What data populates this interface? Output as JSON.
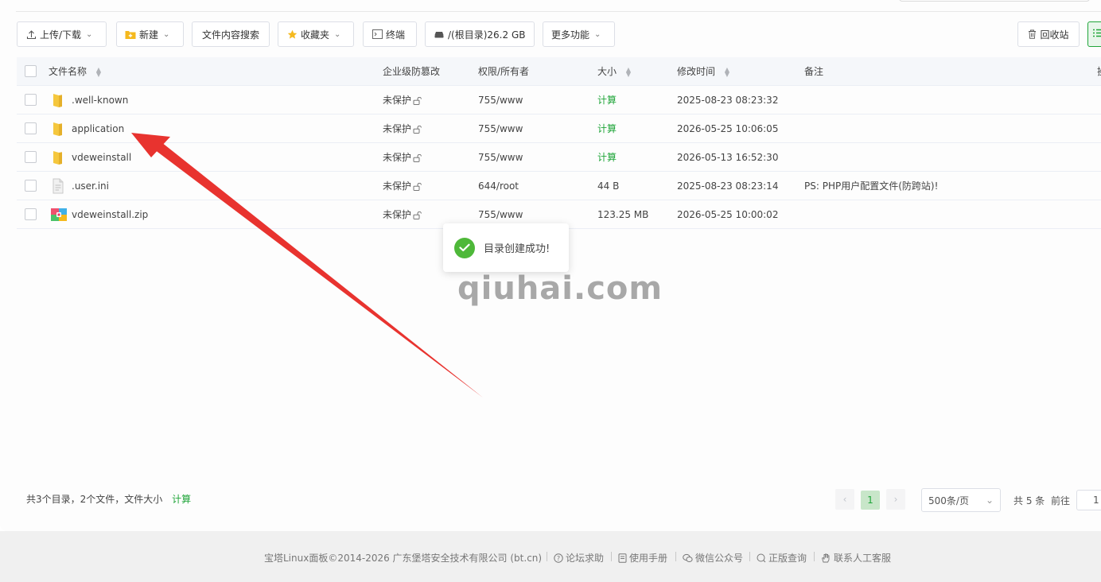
{
  "toolbar": {
    "upload_label": "上传/下载",
    "new_label": "新建",
    "search_content_label": "文件内容搜索",
    "favorites_label": "收藏夹",
    "terminal_label": "终端",
    "disk_label": "/(根目录)26.2 GB",
    "more_label": "更多功能",
    "recycle_label": "回收站"
  },
  "table": {
    "headers": {
      "name": "文件名称",
      "protect": "企业级防篡改",
      "perm": "权限/所有者",
      "size": "大小",
      "mtime": "修改时间",
      "note": "备注",
      "op": "操"
    },
    "rows": [
      {
        "name": ".well-known",
        "type": "folder",
        "protect": "未保护",
        "perm": "755/www",
        "size": "计算",
        "mtime": "2025-08-23 08:23:32",
        "note": ""
      },
      {
        "name": "application",
        "type": "folder",
        "protect": "未保护",
        "perm": "755/www",
        "size": "计算",
        "mtime": "2026-05-25 10:06:05",
        "note": ""
      },
      {
        "name": "vdeweinstall",
        "type": "folder",
        "protect": "未保护",
        "perm": "755/www",
        "size": "计算",
        "mtime": "2026-05-13 16:52:30",
        "note": ""
      },
      {
        "name": ".user.ini",
        "type": "file",
        "protect": "未保护",
        "perm": "644/root",
        "size": "44 B",
        "mtime": "2025-08-23 08:23:14",
        "note": "PS: PHP用户配置文件(防跨站)!"
      },
      {
        "name": "vdeweinstall.zip",
        "type": "zip",
        "protect": "未保护",
        "perm": "755/www",
        "size": "123.25 MB",
        "mtime": "2026-05-25 10:00:02",
        "note": ""
      }
    ]
  },
  "toast": {
    "message": "目录创建成功!"
  },
  "watermark": "qiuhai.com",
  "summary": {
    "text": "共3个目录，2个文件，文件大小",
    "calc": "计算"
  },
  "pagination": {
    "current": "1",
    "page_size": "500条/页",
    "total": "共 5 条",
    "goto_label": "前往",
    "goto_value": "1"
  },
  "footer": {
    "copyright": "宝塔Linux面板©2014-2026 广东堡塔安全技术有限公司 (bt.cn)",
    "forum": "论坛求助",
    "manual": "使用手册",
    "wechat": "微信公众号",
    "verify": "正版查询",
    "support": "联系人工客服"
  },
  "colors": {
    "accent": "#20a53a",
    "arrow": "#e8332f",
    "folder": "#f5c73d"
  }
}
